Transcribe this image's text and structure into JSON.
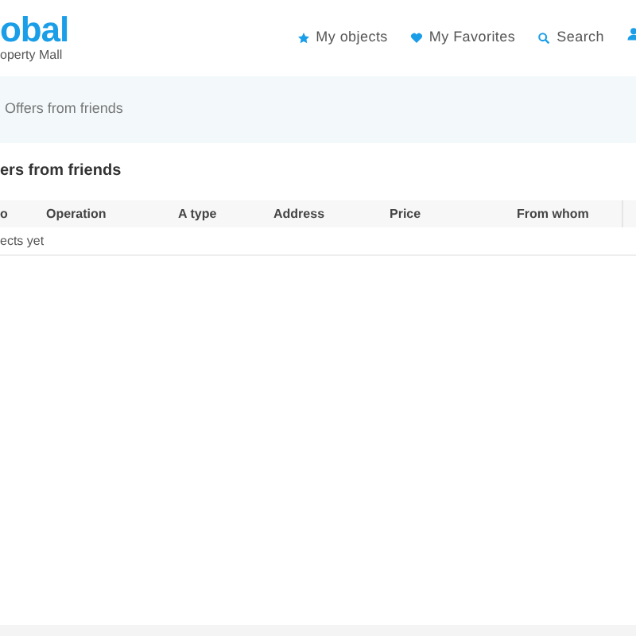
{
  "logo": {
    "name": "obal",
    "tagline": "operty Mall"
  },
  "nav": [
    {
      "label": "My objects"
    },
    {
      "label": "My Favorites"
    },
    {
      "label": "Search"
    }
  ],
  "breadcrumb": "Offers from friends",
  "heading": "ers from friends",
  "table": {
    "columns": [
      "o",
      "Operation",
      "A type",
      "Address",
      "Price",
      "From whom"
    ],
    "empty_message": "ects yet"
  }
}
